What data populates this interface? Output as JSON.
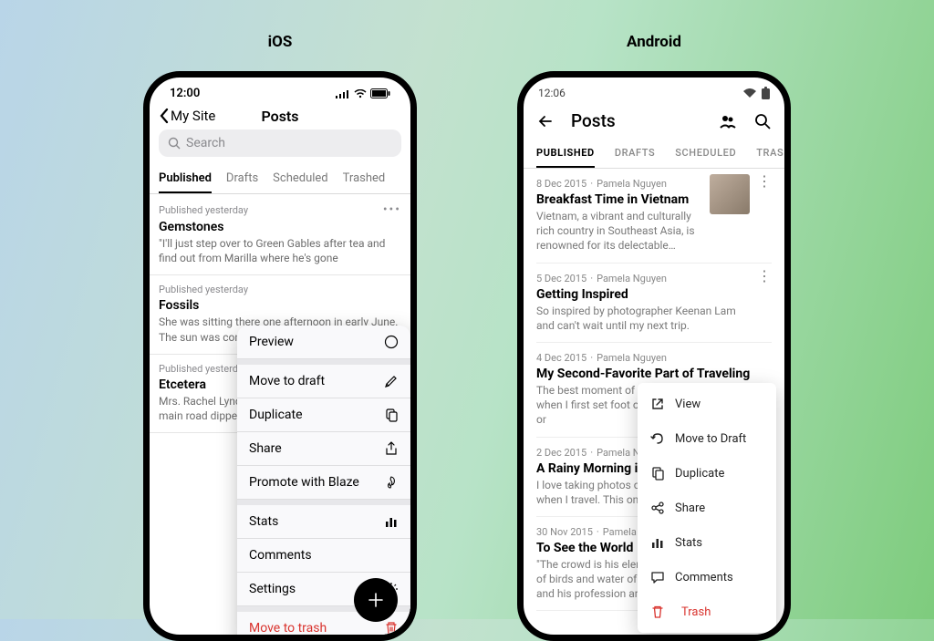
{
  "labels": {
    "ios": "iOS",
    "android": "Android"
  },
  "ios": {
    "time": "12:00",
    "back": "My Site",
    "title": "Posts",
    "search_placeholder": "Search",
    "tabs": [
      "Published",
      "Drafts",
      "Scheduled",
      "Trashed"
    ],
    "active_tab": 0,
    "posts": [
      {
        "meta": "Published yesterday",
        "title": "Gemstones",
        "excerpt": "\"I'll just step over to Green Gables after tea and find out from Marilla where he's gone"
      },
      {
        "meta": "Published yesterday",
        "title": "Fossils",
        "excerpt": "She was sitting there one afternoon in early June. The sun was coming in"
      },
      {
        "meta": "Published yesterday",
        "title": "Etcetera",
        "excerpt": "Mrs. Rachel Lynde lived just where the Avonlea main road dipped down"
      }
    ],
    "menu": [
      {
        "label": "Preview",
        "icon": "compass"
      },
      {
        "label": "Move to draft",
        "icon": "pencil"
      },
      {
        "label": "Duplicate",
        "icon": "copy"
      },
      {
        "label": "Share",
        "icon": "share-ios"
      },
      {
        "label": "Promote with Blaze",
        "icon": "flame"
      },
      {
        "label": "Stats",
        "icon": "bars"
      },
      {
        "label": "Comments",
        "icon": ""
      },
      {
        "label": "Settings",
        "icon": "gear"
      },
      {
        "label": "Move to trash",
        "icon": "trash",
        "danger": true
      }
    ]
  },
  "android": {
    "time": "12:06",
    "title": "Posts",
    "tabs": [
      "PUBLISHED",
      "DRAFTS",
      "SCHEDULED",
      "TRASHED"
    ],
    "active_tab": 0,
    "posts": [
      {
        "date": "8 Dec 2015",
        "author": "Pamela Nguyen",
        "title": "Breakfast Time in Vietnam",
        "excerpt": "Vietnam, a vibrant and culturally rich country in Southeast Asia, is renowned for its delectable…",
        "thumb": true
      },
      {
        "date": "5 Dec 2015",
        "author": "Pamela Nguyen",
        "title": "Getting Inspired",
        "excerpt": "So inspired by photographer Keenan Lam and can't wait until my next trip."
      },
      {
        "date": "4 Dec 2015",
        "author": "Pamela Nguyen",
        "title": "My Second-Favorite Part of Traveling",
        "excerpt": "The best moment of any trip, for me, is when I first set foot off the plane (or boat, or"
      },
      {
        "date": "2 Dec 2015",
        "author": "Pamela Nguyen",
        "title": "A Rainy Morning in Northampton",
        "excerpt": "I love taking photos of murals and street art when I travel. This one's on a"
      },
      {
        "date": "30 Nov 2015",
        "author": "Pamela Nguyen",
        "title": "To See the World",
        "excerpt": "\"The crowd is his element, as the air is that of birds and water of fishes. His passion and his profession are to b…"
      }
    ],
    "menu": [
      {
        "label": "View",
        "icon": "external"
      },
      {
        "label": "Move to Draft",
        "icon": "undo"
      },
      {
        "label": "Duplicate",
        "icon": "copy"
      },
      {
        "label": "Share",
        "icon": "share-android"
      },
      {
        "label": "Stats",
        "icon": "bars"
      },
      {
        "label": "Comments",
        "icon": "comment"
      },
      {
        "label": "Trash",
        "icon": "trash",
        "danger": true
      }
    ]
  }
}
